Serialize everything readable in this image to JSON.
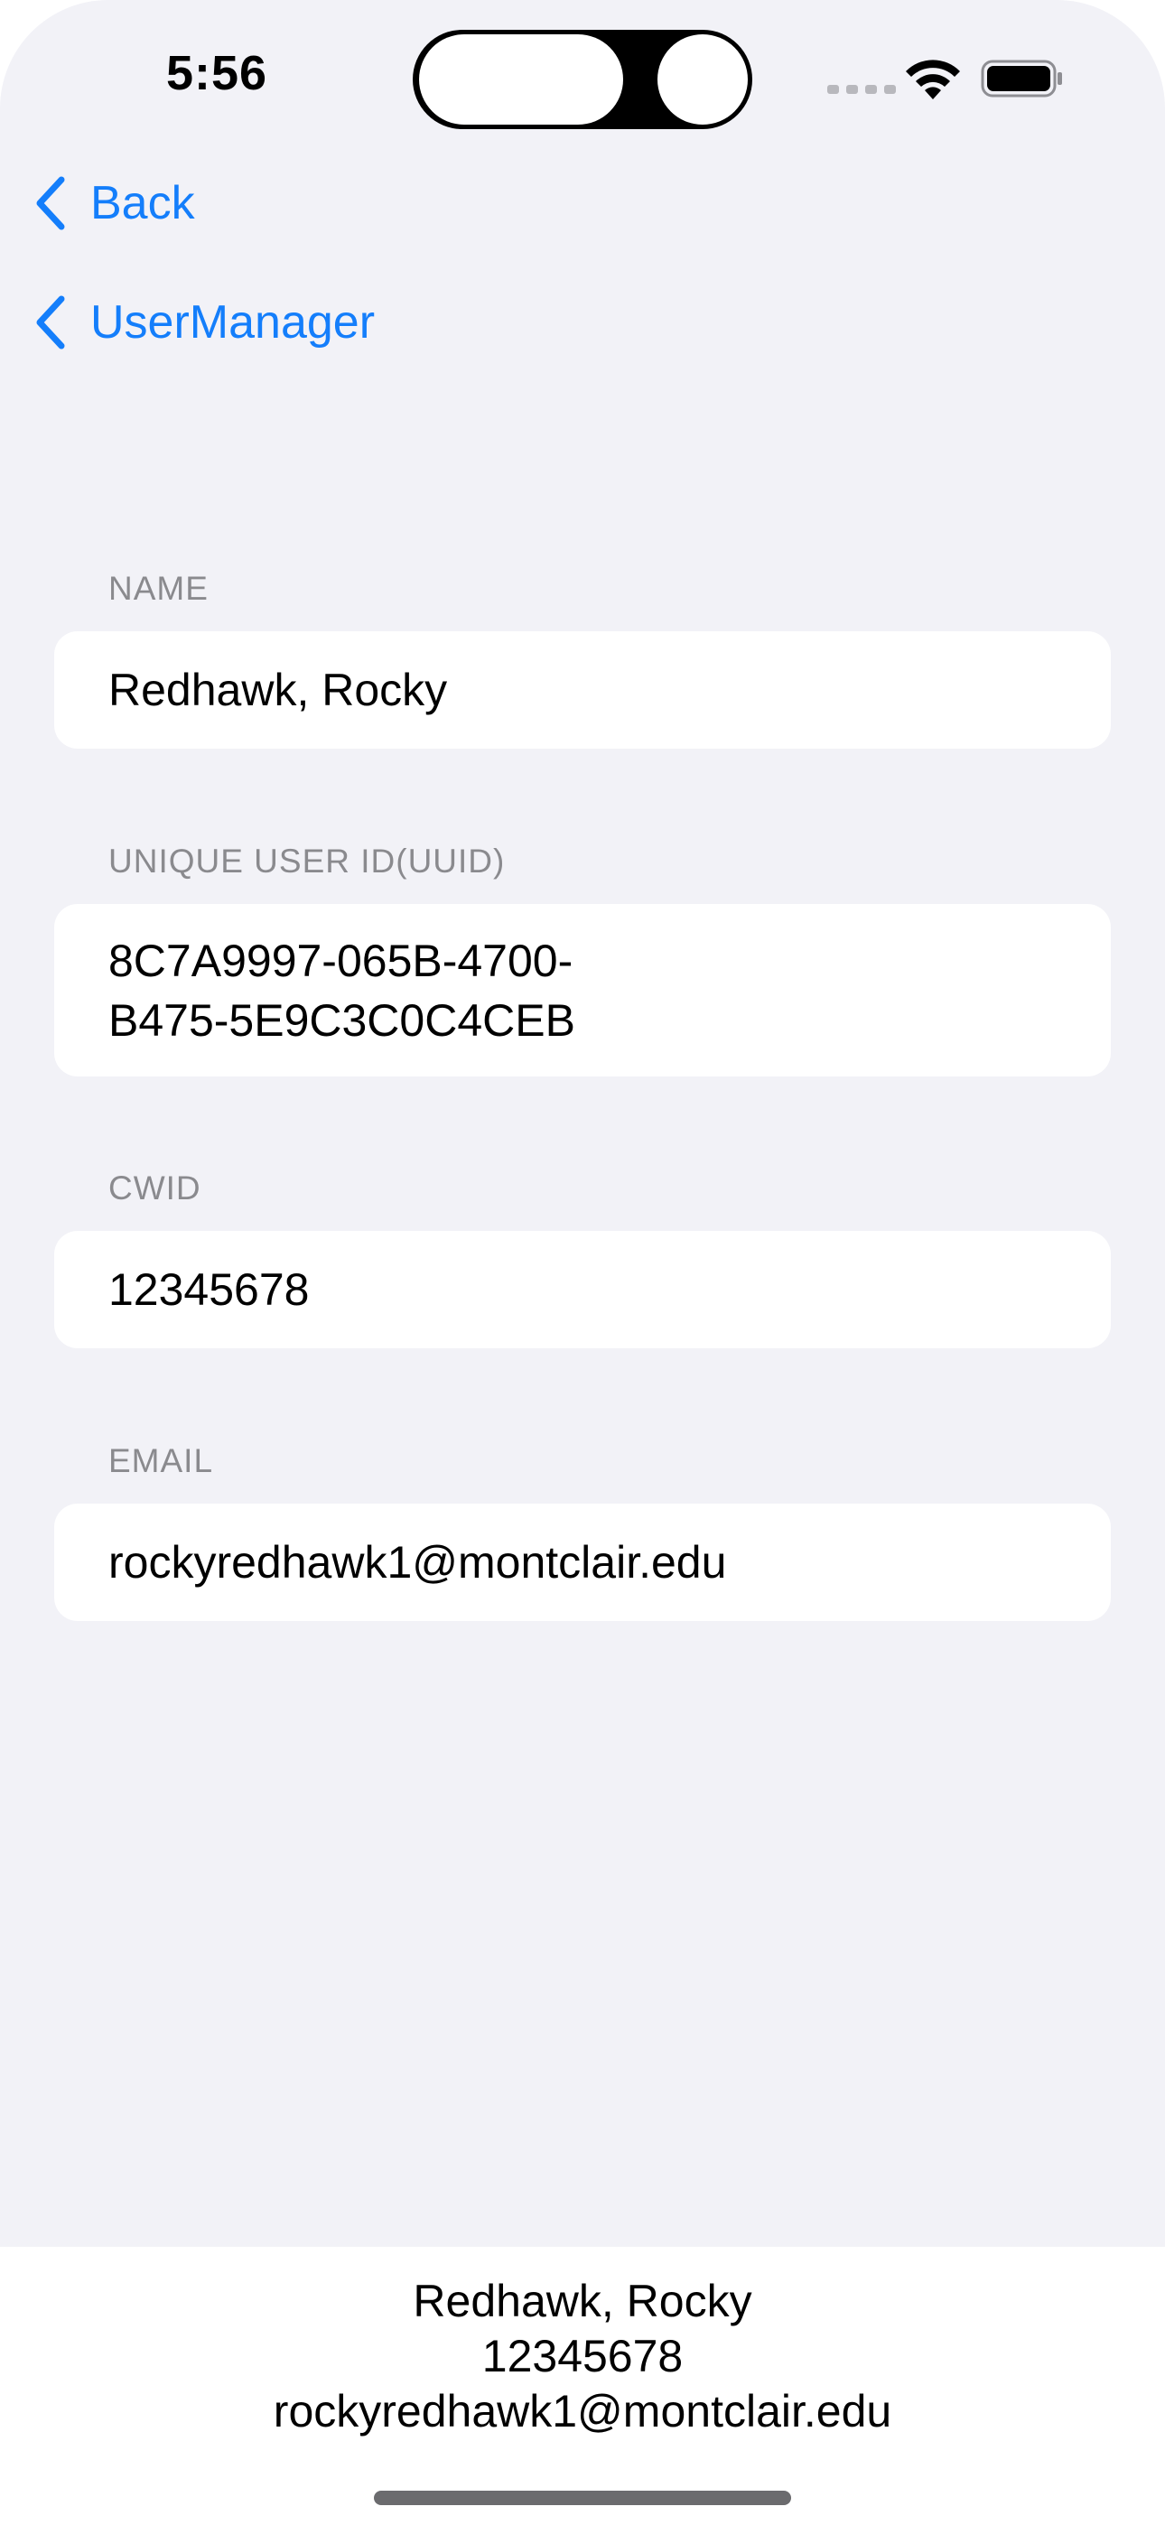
{
  "status_bar": {
    "time": "5:56"
  },
  "nav": {
    "back_label": "Back",
    "parent_label": "UserManager"
  },
  "form": {
    "name": {
      "header": "NAME",
      "value": "Redhawk, Rocky"
    },
    "uuid": {
      "header": "UNIQUE USER ID(UUID)",
      "value_line1": "8C7A9997-065B-4700-",
      "value_line2": "B475-5E9C3C0C4CEB"
    },
    "cwid": {
      "header": "CWID",
      "value": "12345678"
    },
    "email": {
      "header": "EMAIL",
      "value": "rockyredhawk1@montclair.edu"
    }
  },
  "summary": {
    "name": "Redhawk, Rocky",
    "cwid": "12345678",
    "email": "rockyredhawk1@montclair.edu"
  },
  "colors": {
    "accent": "#147efb",
    "background": "#f2f2f7",
    "card": "#ffffff",
    "secondary_text": "#8a8a8e"
  },
  "icons": {
    "back": "chevron-left-icon",
    "wifi": "wifi-icon",
    "battery": "battery-icon",
    "signal": "cellular-signal-icon"
  }
}
